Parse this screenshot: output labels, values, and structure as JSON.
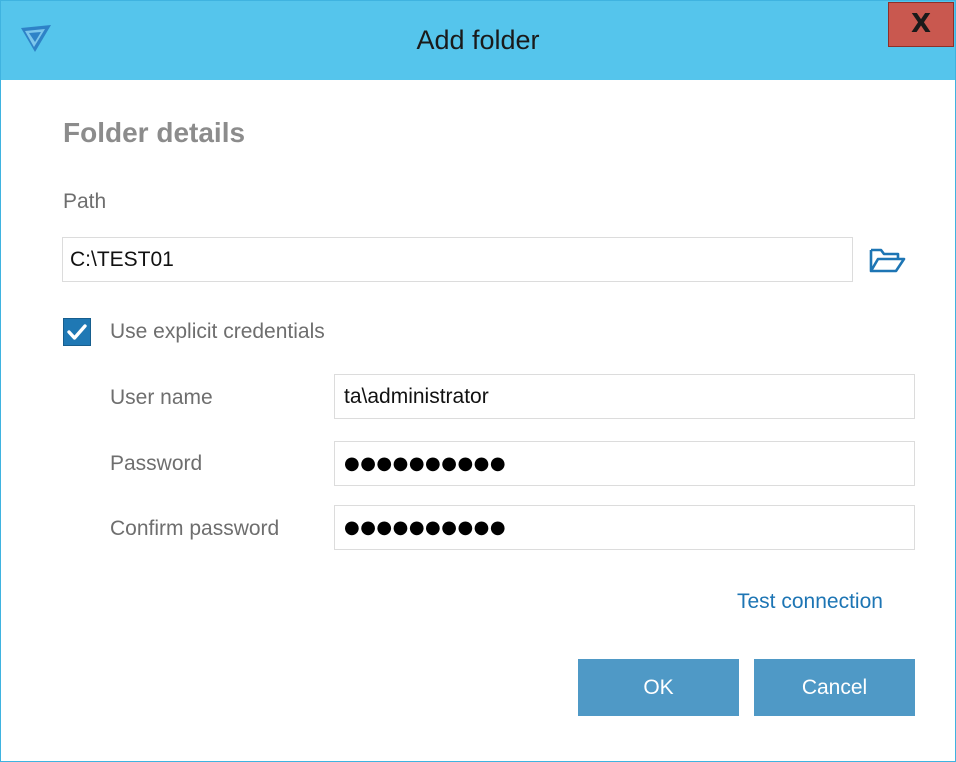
{
  "window": {
    "title": "Add folder",
    "close_label": "X",
    "accent_color": "#55c5ec",
    "close_color": "#c9584f"
  },
  "section": {
    "title": "Folder details"
  },
  "path": {
    "label": "Path",
    "value": "C:\\TEST01",
    "browse_icon": "folder-open-icon"
  },
  "credentials": {
    "checkbox_label": "Use explicit credentials",
    "checked": true,
    "user_name_label": "User name",
    "user_name_value": "ta\\administrator",
    "password_label": "Password",
    "password_value": "●●●●●●●●●●",
    "confirm_label": "Confirm password",
    "confirm_value": "●●●●●●●●●●"
  },
  "actions": {
    "test_connection": "Test connection",
    "ok": "OK",
    "cancel": "Cancel",
    "button_color": "#4f99c6",
    "link_color": "#1d75b4"
  }
}
